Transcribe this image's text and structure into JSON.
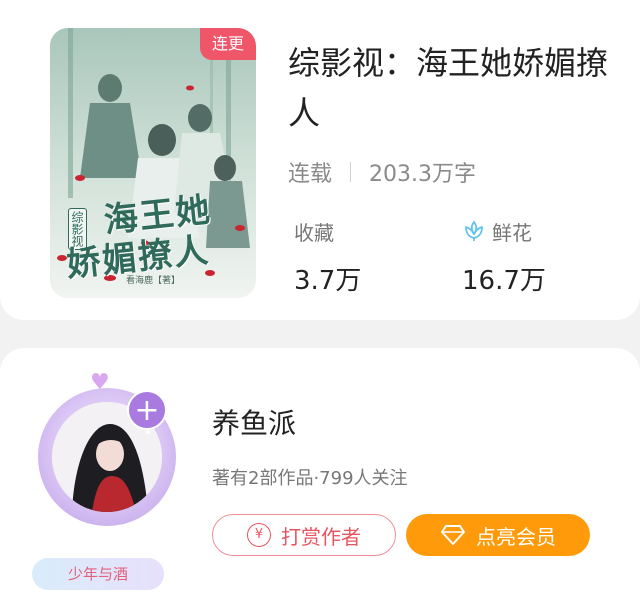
{
  "book": {
    "cover_badge": "连更",
    "cover_art_sub": "综影视",
    "cover_art_line1": "海王她",
    "cover_art_line2": "娇媚撩人",
    "cover_author": "看海鹿【著】",
    "title": "综影视：海王她娇媚撩人",
    "status": "连载",
    "word_count": "203.3万字",
    "stats": {
      "favorites_label": "收藏",
      "favorites_value": "3.7万",
      "flowers_label": "鲜花",
      "flowers_value": "16.7万"
    }
  },
  "author": {
    "name": "养鱼派",
    "stats_line": "著有2部作品·799人关注",
    "avatar_tag": "少年与酒",
    "avatar_plus": "+",
    "tip_button": "打赏作者",
    "member_button": "点亮会员",
    "yen_symbol": "¥"
  },
  "colors": {
    "badge": "#f0566a",
    "tip": "#e8555f",
    "member": "#ff9a0a",
    "flower_icon": "#5fc3ea",
    "avatar_accent": "#a97ae0"
  },
  "icons": {
    "flower": "lotus-flower-icon",
    "yen": "yen-coin-icon",
    "member": "diamond-icon",
    "follow": "plus-icon"
  }
}
